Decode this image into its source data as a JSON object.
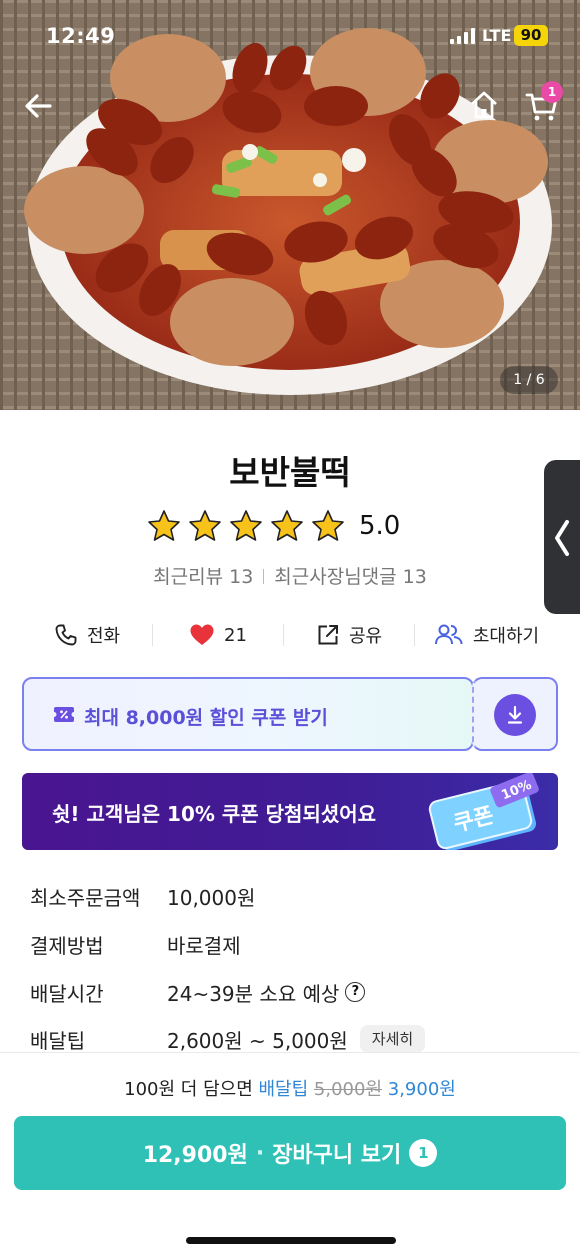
{
  "status_bar": {
    "time": "12:49",
    "network": "LTE",
    "battery": "90"
  },
  "hero": {
    "photo_counter": "1 / 6",
    "cart_badge": "1"
  },
  "store": {
    "name": "보반불떡",
    "rating": "5.0",
    "stars": 5,
    "recent_reviews": "최근리뷰 13",
    "owner_replies": "최근사장님댓글 13"
  },
  "actions": {
    "call": "전화",
    "like_count": "21",
    "share": "공유",
    "invite": "초대하기"
  },
  "coupon": {
    "label": "최대 8,000원 할인 쿠폰 받기"
  },
  "promo": {
    "text": "쉿! 고객님은 10% 쿠폰 당첨되셨어요",
    "badge": "10%",
    "coupon_word": "쿠폰"
  },
  "info": {
    "min_order_label": "최소주문금액",
    "min_order_value": "10,000원",
    "payment_label": "결제방법",
    "payment_value": "바로결제",
    "delivery_time_label": "배달시간",
    "delivery_time_value": "24~39분 소요 예상",
    "delivery_tip_label": "배달팁",
    "delivery_tip_value": "2,600원 ~ 5,000원",
    "detail_button": "자세히"
  },
  "bottom": {
    "tip_prefix": "100원 더 담으면",
    "tip_label": "배달팁",
    "tip_old": "5,000원",
    "tip_new": "3,900원",
    "cart_price": "12,900원",
    "cart_dot": "·",
    "cart_label": "장바구니 보기",
    "cart_count": "1"
  },
  "colors": {
    "accent_teal": "#2fc0b6",
    "coupon_purple": "#5b51d8",
    "promo_purple": "#4a1590",
    "star_yellow": "#f7c31a",
    "heart_red": "#e8333a"
  }
}
